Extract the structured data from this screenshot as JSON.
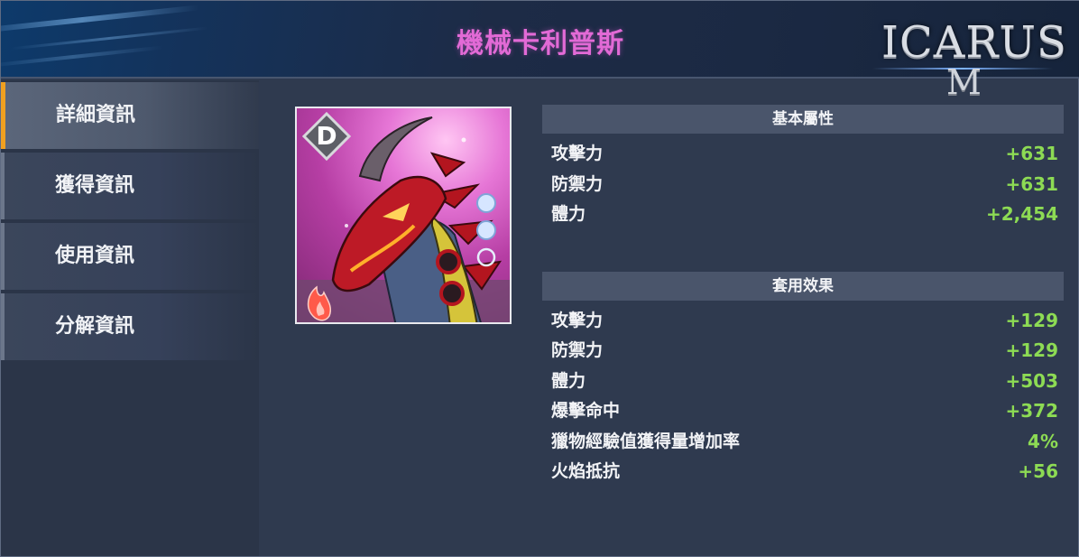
{
  "header": {
    "title": "機械卡利普斯"
  },
  "logo": {
    "word": "ICARUS",
    "letter": "M"
  },
  "sidebar": {
    "tabs": [
      {
        "label": "詳細資訊",
        "active": true
      },
      {
        "label": "獲得資訊",
        "active": false
      },
      {
        "label": "使用資訊",
        "active": false
      },
      {
        "label": "分解資訊",
        "active": false
      }
    ]
  },
  "item": {
    "grade": "D",
    "element_icon": "fire-icon",
    "background_color": "#c24fb1"
  },
  "base_stats": {
    "header": "基本屬性",
    "rows": [
      {
        "label": "攻擊力",
        "value": "+631"
      },
      {
        "label": "防禦力",
        "value": "+631"
      },
      {
        "label": "體力",
        "value": "+2,454"
      }
    ]
  },
  "set_effects": {
    "header": "套用效果",
    "rows": [
      {
        "label": "攻擊力",
        "value": "+129"
      },
      {
        "label": "防禦力",
        "value": "+129"
      },
      {
        "label": "體力",
        "value": "+503"
      },
      {
        "label": "爆擊命中",
        "value": "+372"
      },
      {
        "label": "獵物經驗值獲得量增加率",
        "value": "4%"
      },
      {
        "label": "火焰抵抗",
        "value": "+56"
      }
    ]
  },
  "colors": {
    "title": "#e26ad6",
    "value": "#8ddb54",
    "active_tab_accent": "#f0a020"
  }
}
